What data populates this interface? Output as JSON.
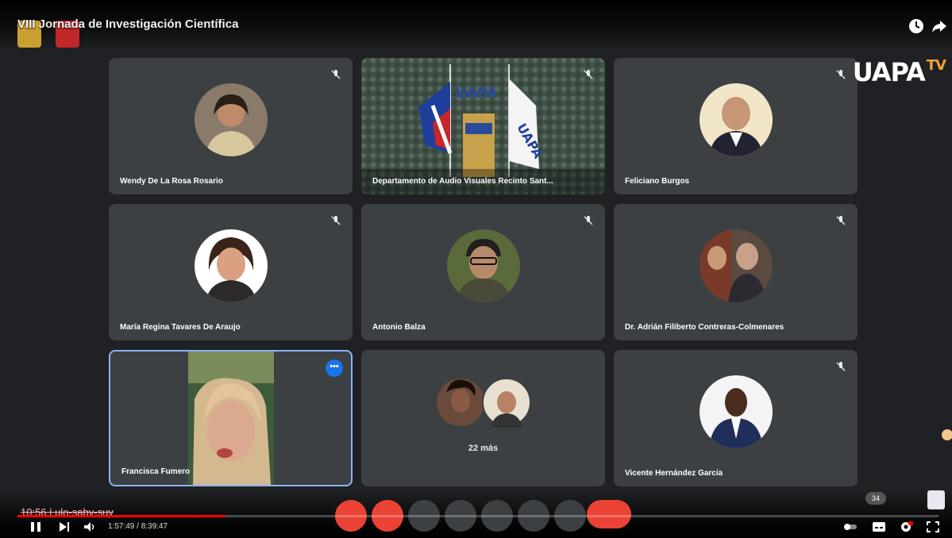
{
  "video": {
    "title": "VIII Jornada de Investigación Científica",
    "time_current_total": "1:57:49 / 8:39:47",
    "chapter_text": "10:56 | ulo-sabv-suy",
    "progress": 0.226
  },
  "branding": {
    "logo_main": "UAPA",
    "logo_suffix": "TV"
  },
  "meeting": {
    "participants": [
      {
        "name": "Wendy De La Rosa Rosario",
        "muted": true,
        "avatar": "woman-photo"
      },
      {
        "name": "Departamento de Audio Visuales Recinto Sant...",
        "muted": true,
        "avatar": "video-flags-podium"
      },
      {
        "name": "Feliciano Burgos",
        "muted": true,
        "avatar": "man-photo"
      },
      {
        "name": "María Regina Tavares De Araujo",
        "muted": true,
        "avatar": "woman-photo"
      },
      {
        "name": "Antonio Balza",
        "muted": true,
        "avatar": "man-glasses-photo"
      },
      {
        "name": "Dr. Adrián Filiberto Contreras-Colmenares",
        "muted": true,
        "avatar": "man-photo"
      },
      {
        "name": "Francisca Fumero",
        "muted": false,
        "avatar": "video-woman-live",
        "active": true
      },
      {
        "name": "",
        "muted": false,
        "avatar": "group-avatars",
        "others_label": "22 más"
      },
      {
        "name": "Vicente Hernández García",
        "muted": true,
        "avatar": "man-suit-photo"
      }
    ],
    "people_count": "34"
  },
  "colors": {
    "tile_bg": "#3c4043",
    "active_border": "#8ab4f8",
    "end_call": "#ea4335",
    "progress": "#ff0000",
    "uapa_tv_accent": "#f0a23a"
  }
}
